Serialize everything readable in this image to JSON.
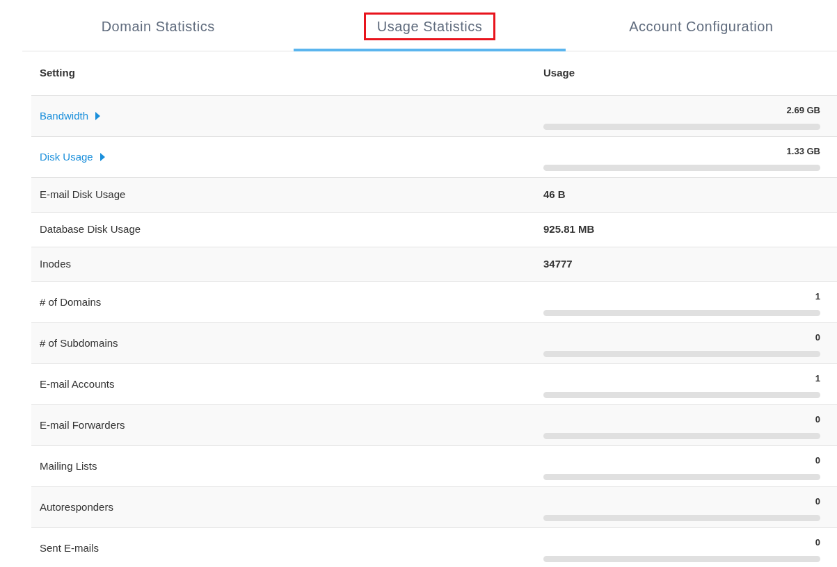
{
  "tabs": [
    {
      "label": "Domain Statistics",
      "selected": false,
      "highlighted": false
    },
    {
      "label": "Usage Statistics",
      "selected": true,
      "highlighted": true
    },
    {
      "label": "Account Configuration",
      "selected": false,
      "highlighted": false
    }
  ],
  "table": {
    "columns": [
      "Setting",
      "Usage"
    ],
    "rows": [
      {
        "setting": "Bandwidth",
        "expandable": true,
        "kind": "bar",
        "value": "2.69 GB",
        "level": 0
      },
      {
        "setting": "Disk Usage",
        "expandable": true,
        "kind": "bar",
        "value": "1.33 GB",
        "level": 0
      },
      {
        "setting": "E-mail Disk Usage",
        "expandable": false,
        "kind": "plain",
        "value": "46 B"
      },
      {
        "setting": "Database Disk Usage",
        "expandable": false,
        "kind": "plain",
        "value": "925.81 MB"
      },
      {
        "setting": "Inodes",
        "expandable": false,
        "kind": "plain",
        "value": "34777"
      },
      {
        "setting": "# of Domains",
        "expandable": false,
        "kind": "bar",
        "value": "1",
        "level": 0
      },
      {
        "setting": "# of Subdomains",
        "expandable": false,
        "kind": "bar",
        "value": "0",
        "level": 0
      },
      {
        "setting": "E-mail Accounts",
        "expandable": false,
        "kind": "bar",
        "value": "1",
        "level": 0
      },
      {
        "setting": "E-mail Forwarders",
        "expandable": false,
        "kind": "bar",
        "value": "0",
        "level": 0
      },
      {
        "setting": "Mailing Lists",
        "expandable": false,
        "kind": "bar",
        "value": "0",
        "level": 0
      },
      {
        "setting": "Autoresponders",
        "expandable": false,
        "kind": "bar",
        "value": "0",
        "level": 0
      },
      {
        "setting": "Sent E-mails",
        "expandable": false,
        "kind": "bar",
        "value": "0",
        "level": 0
      }
    ]
  }
}
